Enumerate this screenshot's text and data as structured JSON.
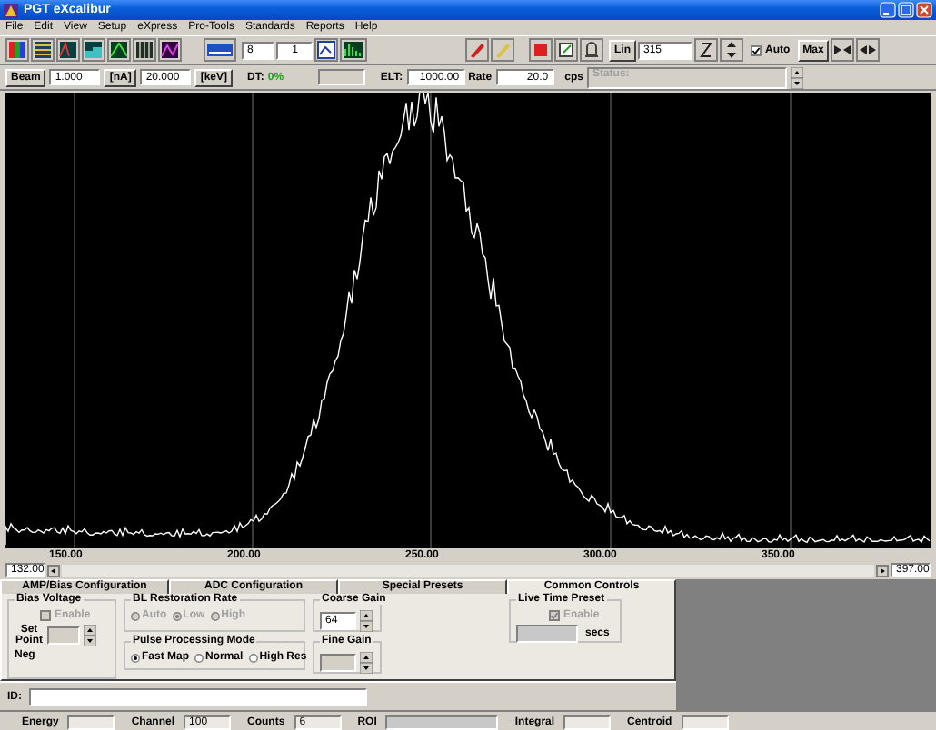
{
  "window": {
    "title": "PGT eXcalibur"
  },
  "menu": [
    "File",
    "Edit",
    "View",
    "Setup",
    "eXpress",
    "Pro-Tools",
    "Standards",
    "Reports",
    "Help"
  ],
  "toolbar": {
    "detector": "8",
    "group": "1",
    "scale_button": "Lin",
    "scale_value": "315",
    "auto": {
      "label": "Auto",
      "checked": true
    },
    "max_button": "Max"
  },
  "acquisition": {
    "beam_label": "Beam",
    "beam_current": "1.000",
    "current_unit": "[nA]",
    "beam_energy": "20.000",
    "energy_unit": "[keV]",
    "dt_label": "DT:",
    "dt_value": "0%",
    "elt_label": "ELT:",
    "elt_value": "1000.00",
    "rate_label": "Rate",
    "rate_value": "20.0",
    "rate_unit": "cps",
    "status_label": "Status:"
  },
  "spectrum": {
    "axis_labels": [
      "150.00",
      "200.00",
      "250.00",
      "300.00",
      "350.00"
    ],
    "range_start": "132.00",
    "range_end": "397.00"
  },
  "tabs": [
    {
      "label": "AMP/Bias Configuration",
      "selected": false
    },
    {
      "label": "ADC Configuration",
      "selected": false
    },
    {
      "label": "Special Presets",
      "selected": false
    },
    {
      "label": "Common Controls",
      "selected": true
    }
  ],
  "bias_voltage": {
    "title": "Bias Voltage",
    "enable": {
      "label": "Enable",
      "checked": false,
      "disabled": true
    },
    "set_point_label": "Set Point",
    "polarity": "Neg"
  },
  "bl_restoration": {
    "title": "BL Restoration Rate",
    "disabled": true,
    "options": [
      {
        "label": "Auto",
        "selected": false
      },
      {
        "label": "Low",
        "selected": true
      },
      {
        "label": "High",
        "selected": false
      }
    ]
  },
  "pulse_mode": {
    "title": "Pulse Processing Mode",
    "disabled": false,
    "options": [
      {
        "label": "Fast Map",
        "selected": true
      },
      {
        "label": "Normal",
        "selected": false
      },
      {
        "label": "High Res",
        "selected": false
      }
    ]
  },
  "coarse_gain": {
    "title": "Coarse Gain",
    "value": "64",
    "disabled": false
  },
  "fine_gain": {
    "title": "Fine Gain",
    "disabled": true
  },
  "live_time": {
    "title": "Live Time Preset",
    "enable": {
      "label": "Enable",
      "checked": true,
      "disabled": true
    },
    "unit": "secs"
  },
  "id_field": {
    "label": "ID:"
  },
  "status_bar": [
    {
      "label": "Energy"
    },
    {
      "label": "Channel",
      "value": "100"
    },
    {
      "label": "Counts",
      "value": "6"
    },
    {
      "label": "ROI"
    },
    {
      "label": "Integral"
    },
    {
      "label": "Centroid"
    }
  ]
}
